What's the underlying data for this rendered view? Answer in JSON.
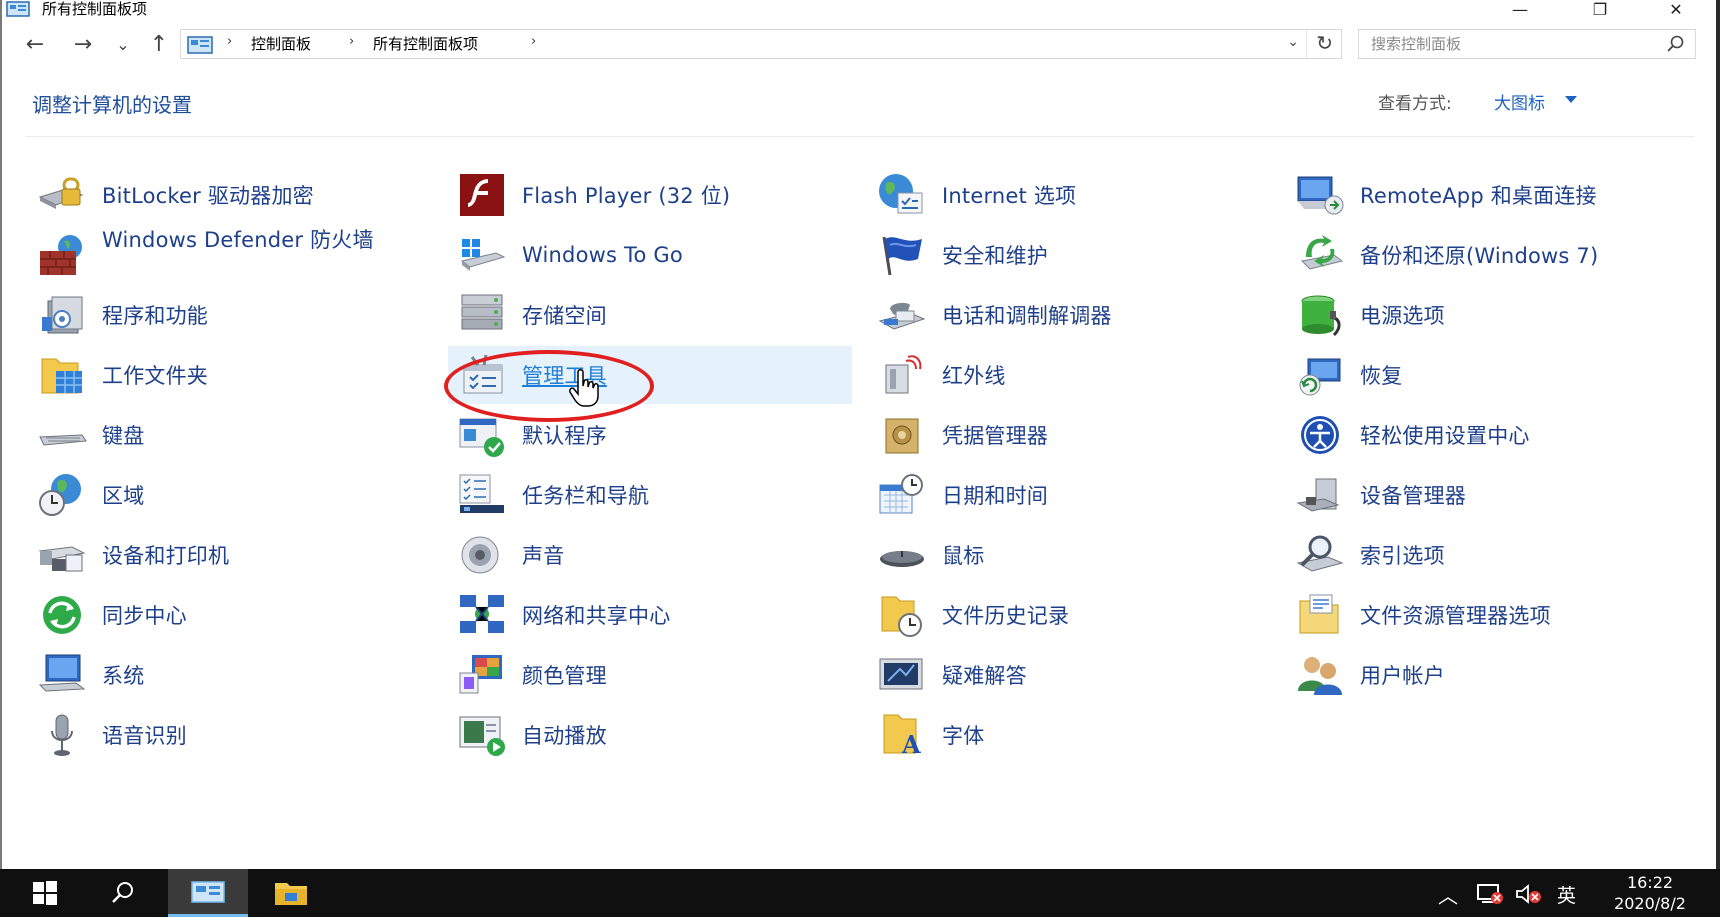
{
  "window": {
    "title": "所有控制面板项",
    "minimize_glyph": "—",
    "restore_glyph": "❐",
    "close_glyph": "✕"
  },
  "navigation": {
    "back_glyph": "←",
    "forward_glyph": "→",
    "recent_glyph": "⌄",
    "up_glyph": "↑",
    "breadcrumbs": [
      "控制面板",
      "所有控制面板项"
    ],
    "separator": "›",
    "dropdown_glyph": "⌄",
    "refresh_glyph": "↻"
  },
  "search": {
    "placeholder": "搜索控制面板"
  },
  "header": {
    "title": "调整计算机的设置",
    "view_label": "查看方式:",
    "view_value": "大图标"
  },
  "items": [
    {
      "label": "BitLocker 驱动器加密",
      "icon": "bitlocker-icon"
    },
    {
      "label": "Flash Player (32 位)",
      "icon": "flash-player-icon"
    },
    {
      "label": "Internet 选项",
      "icon": "internet-options-icon"
    },
    {
      "label": "RemoteApp 和桌面连接",
      "icon": "remoteapp-icon"
    },
    {
      "label": "Windows Defender 防火墙",
      "icon": "firewall-icon"
    },
    {
      "label": "Windows To Go",
      "icon": "windows-to-go-icon"
    },
    {
      "label": "安全和维护",
      "icon": "security-flag-icon"
    },
    {
      "label": "备份和还原(Windows 7)",
      "icon": "backup-restore-icon"
    },
    {
      "label": "程序和功能",
      "icon": "programs-features-icon"
    },
    {
      "label": "存储空间",
      "icon": "storage-spaces-icon"
    },
    {
      "label": "电话和调制解调器",
      "icon": "phone-modem-icon"
    },
    {
      "label": "电源选项",
      "icon": "power-options-icon"
    },
    {
      "label": "工作文件夹",
      "icon": "work-folders-icon"
    },
    {
      "label": "管理工具",
      "icon": "admin-tools-icon"
    },
    {
      "label": "红外线",
      "icon": "infrared-icon"
    },
    {
      "label": "恢复",
      "icon": "recovery-icon"
    },
    {
      "label": "键盘",
      "icon": "keyboard-icon"
    },
    {
      "label": "默认程序",
      "icon": "default-programs-icon"
    },
    {
      "label": "凭据管理器",
      "icon": "credential-manager-icon"
    },
    {
      "label": "轻松使用设置中心",
      "icon": "ease-of-access-icon"
    },
    {
      "label": "区域",
      "icon": "region-icon"
    },
    {
      "label": "任务栏和导航",
      "icon": "taskbar-navigation-icon"
    },
    {
      "label": "日期和时间",
      "icon": "date-time-icon"
    },
    {
      "label": "设备管理器",
      "icon": "device-manager-icon"
    },
    {
      "label": "设备和打印机",
      "icon": "devices-printers-icon"
    },
    {
      "label": "声音",
      "icon": "sound-icon"
    },
    {
      "label": "鼠标",
      "icon": "mouse-icon"
    },
    {
      "label": "索引选项",
      "icon": "indexing-options-icon"
    },
    {
      "label": "同步中心",
      "icon": "sync-center-icon"
    },
    {
      "label": "网络和共享中心",
      "icon": "network-sharing-icon"
    },
    {
      "label": "文件历史记录",
      "icon": "file-history-icon"
    },
    {
      "label": "文件资源管理器选项",
      "icon": "explorer-options-icon"
    },
    {
      "label": "系统",
      "icon": "system-icon"
    },
    {
      "label": "颜色管理",
      "icon": "color-management-icon"
    },
    {
      "label": "疑难解答",
      "icon": "troubleshooting-icon"
    },
    {
      "label": "用户帐户",
      "icon": "user-accounts-icon"
    },
    {
      "label": "语音识别",
      "icon": "speech-recognition-icon"
    },
    {
      "label": "自动播放",
      "icon": "autoplay-icon"
    },
    {
      "label": "字体",
      "icon": "fonts-icon"
    }
  ],
  "hovered_item": "管理工具",
  "taskbar": {
    "tray_chevron": "︿",
    "ime": "英",
    "time": "16:22",
    "date": "2020/8/2"
  },
  "colors": {
    "link": "#1e3f8a",
    "heading": "#1e4e9b",
    "hover_bg": "#e5f1fb",
    "annotation_ring": "#e02020",
    "taskbar": "#101010"
  }
}
